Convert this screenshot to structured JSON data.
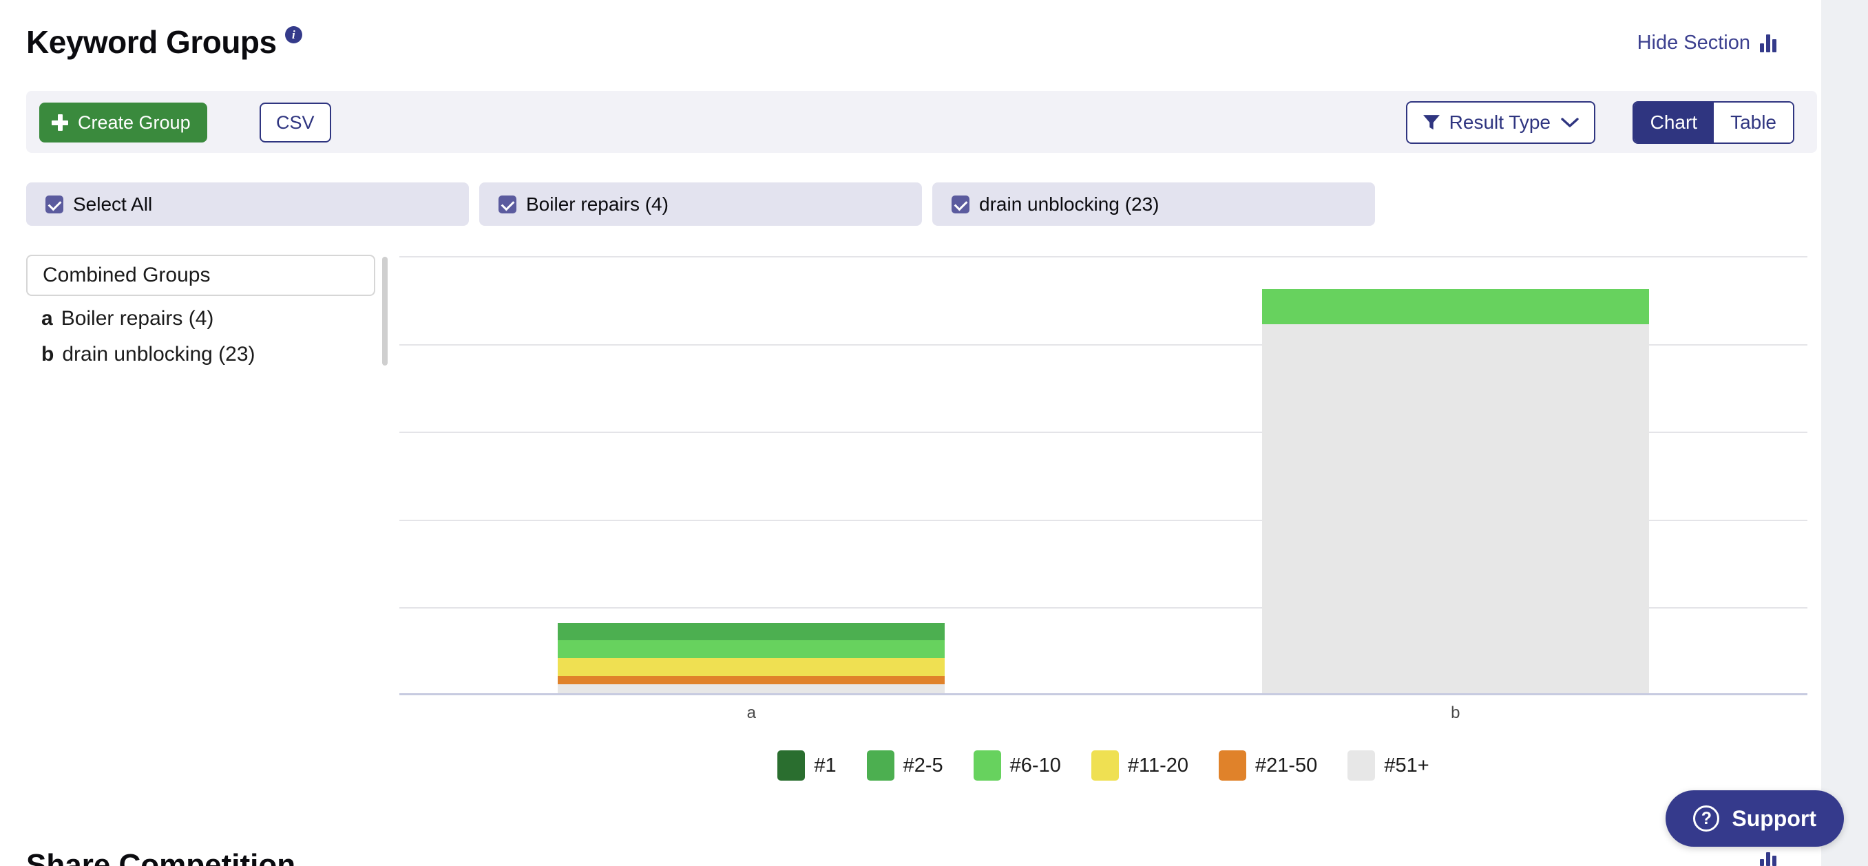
{
  "header": {
    "title": "Keyword Groups",
    "info_icon": "info-icon",
    "hide_section_label": "Hide Section",
    "hide_section_icon": "bar-chart-icon"
  },
  "toolbar": {
    "create_group_label": "Create Group",
    "create_group_icon": "plus-icon",
    "csv_label": "CSV",
    "result_type_label": "Result Type",
    "result_type_icon": "funnel-icon",
    "result_type_chevron": "chevron-down-icon",
    "view_chart_label": "Chart",
    "view_table_label": "Table",
    "active_view": "Chart"
  },
  "filters": [
    {
      "label": "Select All",
      "checked": true
    },
    {
      "label": "Boiler repairs (4)",
      "checked": true
    },
    {
      "label": "drain unblocking (23)",
      "checked": true
    }
  ],
  "groups_panel": {
    "header": "Combined Groups",
    "rows": [
      {
        "key": "a",
        "label": "Boiler repairs (4)"
      },
      {
        "key": "b",
        "label": "drain unblocking (23)"
      }
    ]
  },
  "colors": {
    "rank_1": "#2a6e2f",
    "rank_2_5": "#4caf50",
    "rank_6_10": "#67d25e",
    "rank_11_20": "#efe052",
    "rank_21_50": "#e0822a",
    "rank_51_plus": "#e7e7e7",
    "brand_navy": "#2f3580",
    "brand_green": "#3a8a3d",
    "chip_bg": "#e3e3ef",
    "checkbox": "#5b5b9e"
  },
  "chart_data": {
    "type": "bar",
    "stacked": true,
    "title": "",
    "xlabel": "",
    "ylabel": "",
    "categories": [
      "a",
      "b"
    ],
    "category_names": [
      "Boiler repairs (4)",
      "drain unblocking (23)"
    ],
    "series": [
      {
        "name": "#1",
        "color": "#2a6e2f",
        "values": [
          0,
          0
        ]
      },
      {
        "name": "#2-5",
        "color": "#4caf50",
        "values": [
          1,
          0
        ]
      },
      {
        "name": "#6-10",
        "color": "#67d25e",
        "values": [
          1,
          2
        ]
      },
      {
        "name": "#11-20",
        "color": "#efe052",
        "values": [
          1,
          0
        ]
      },
      {
        "name": "#21-50",
        "color": "#e0822a",
        "values": [
          0.5,
          0
        ]
      },
      {
        "name": "#51+",
        "color": "#e7e7e7",
        "values": [
          0.5,
          21
        ]
      }
    ],
    "totals": [
      4,
      23
    ],
    "ylim": [
      0,
      25
    ],
    "grid": true,
    "gridlines": 5,
    "legend_position": "bottom",
    "legend_entries": [
      "#1",
      "#2-5",
      "#6-10",
      "#11-20",
      "#21-50",
      "#51+"
    ]
  },
  "support": {
    "label": "Support",
    "icon": "question-circle-icon"
  }
}
